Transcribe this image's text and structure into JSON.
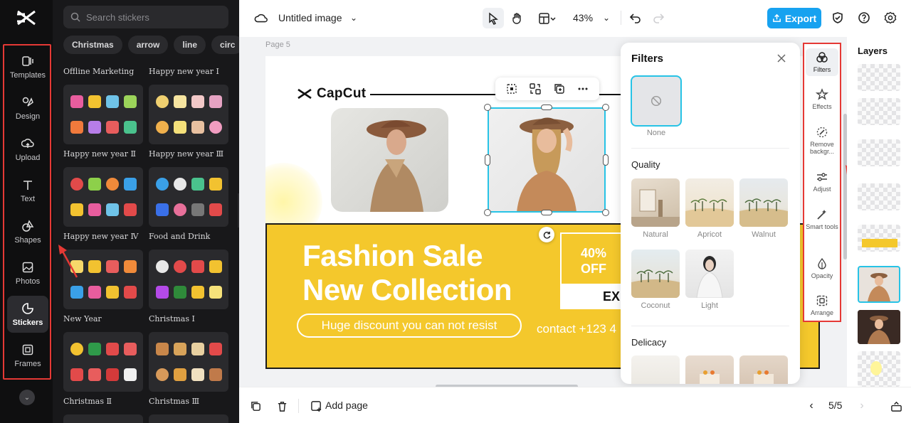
{
  "rail": {
    "items": [
      {
        "label": "Templates",
        "icon": "templates-icon"
      },
      {
        "label": "Design",
        "icon": "design-icon"
      },
      {
        "label": "Upload",
        "icon": "upload-icon"
      },
      {
        "label": "Text",
        "icon": "text-icon"
      },
      {
        "label": "Shapes",
        "icon": "shapes-icon"
      },
      {
        "label": "Photos",
        "icon": "photos-icon"
      },
      {
        "label": "Stickers",
        "icon": "stickers-icon",
        "active": true
      },
      {
        "label": "Frames",
        "icon": "frames-icon"
      }
    ]
  },
  "stickers": {
    "search_placeholder": "Search stickers",
    "chips": [
      "Christmas",
      "arrow",
      "line",
      "circ"
    ],
    "sections": [
      "Offline Marketing",
      "Happy new year Ⅰ",
      "Happy new year Ⅱ",
      "Happy new year Ⅲ",
      "Happy new year Ⅳ",
      "Food and Drink",
      "New Year",
      "Christmas Ⅰ",
      "Christmas Ⅱ",
      "Christmas Ⅲ"
    ]
  },
  "topbar": {
    "title": "Untitled image",
    "zoom": "43%",
    "export_label": "Export"
  },
  "canvas": {
    "page_label": "Page 5",
    "brand": "CapCut",
    "headline_1": "Fashion Sale",
    "headline_2": "New Collection",
    "pill_text": "Huge discount you can not resist",
    "off_line1": "40%",
    "off_line2": "OFF",
    "off_cta": "EX",
    "contact": "contact +123 4"
  },
  "filters": {
    "title": "Filters",
    "none_label": "None",
    "quality_title": "Quality",
    "quality_items": [
      "Natural",
      "Apricot",
      "Walnut",
      "Coconut",
      "Light"
    ],
    "delicacy_title": "Delicacy"
  },
  "tools": [
    {
      "label": "Filters",
      "icon": "filters-icon",
      "active": true
    },
    {
      "label": "Effects",
      "icon": "effects-icon"
    },
    {
      "label": "Remove backgr...",
      "icon": "remove-background-icon"
    },
    {
      "label": "Adjust",
      "icon": "adjust-icon"
    },
    {
      "label": "Smart tools",
      "icon": "smart-tools-icon"
    },
    {
      "label": "Opacity",
      "icon": "opacity-icon"
    },
    {
      "label": "Arrange",
      "icon": "arrange-icon"
    }
  ],
  "layers": {
    "title": "Layers"
  },
  "bottombar": {
    "add_page": "Add page",
    "page_count": "5/5"
  },
  "colors": {
    "accent": "#17a2f0",
    "selection": "#27c3e6",
    "highlight_box": "#e53935",
    "banner_yellow": "#f4c82c"
  }
}
